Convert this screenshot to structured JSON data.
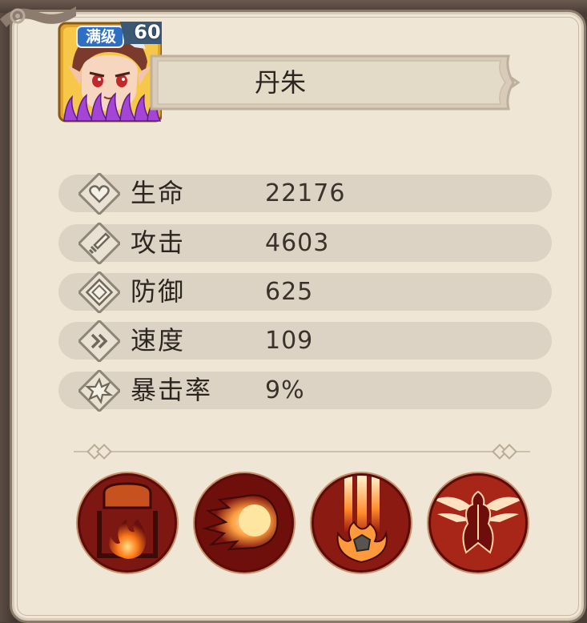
{
  "hero": {
    "name": "丹朱",
    "level": "60",
    "badge": "满级"
  },
  "stats": [
    {
      "label": "生命",
      "value": "22176",
      "icon": "heart-icon"
    },
    {
      "label": "攻击",
      "value": "4603",
      "icon": "sword-icon"
    },
    {
      "label": "防御",
      "value": "625",
      "icon": "shield-icon"
    },
    {
      "label": "速度",
      "value": "109",
      "icon": "speed-arrows-icon"
    },
    {
      "label": "暴击率",
      "value": "9%",
      "icon": "critical-burst-icon"
    }
  ],
  "skills": [
    {
      "name": "fire-cauldron-skill-icon"
    },
    {
      "name": "fireball-skill-icon"
    },
    {
      "name": "flaming-meteor-skill-icon"
    },
    {
      "name": "phoenix-skill-icon"
    }
  ],
  "colors": {
    "panel": "#efe6d5",
    "stat_row": "#dcd3c4",
    "skill_ring": "#7a1410",
    "level_badge": "#4aa3e0"
  }
}
